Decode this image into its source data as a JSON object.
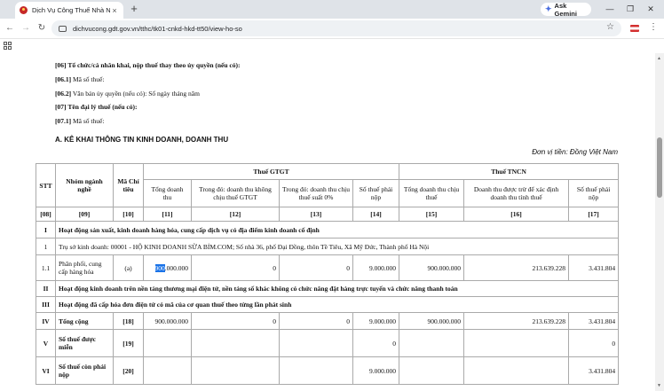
{
  "browser": {
    "tab_title": "Dịch Vụ Công Thuế Nhà Nước",
    "tab_close": "×",
    "new_tab": "+",
    "gemini_label": "Ask Gemini",
    "url": "dichvucong.gdt.gov.vn/tthc/tk01-cnkd-hkd-tt50/view-ho-so",
    "icons": [
      "back-arrow-icon",
      "forward-arrow-icon",
      "reload-icon",
      "site-settings-icon",
      "bookmark-star-icon",
      "menu-icon",
      "apps-icon",
      "minimize-icon",
      "maximize-icon",
      "close-icon"
    ]
  },
  "form": {
    "f06": {
      "code": "[06]",
      "text": "Tổ chức/cá nhân khai, nộp thuế thay theo ủy quyền (nếu có):"
    },
    "f061": {
      "code": "[06.1]",
      "text": "Mã số thuế:"
    },
    "f062": {
      "code": "[06.2]",
      "text": "Văn bản ủy quyền (nếu có): Số ngày tháng năm"
    },
    "f07": {
      "code": "[07]",
      "text": "Tên đại lý thuế (nếu có):"
    },
    "f071": {
      "code": "[07.1]",
      "text": "Mã số thuế:"
    },
    "section_a": "A. KÊ KHAI THÔNG TIN KINH DOANH, DOANH THU",
    "currency": "Đơn vị tiền: Đồng Việt Nam"
  },
  "table": {
    "headers": {
      "stt": "STT",
      "nhom": "Nhóm ngành nghề",
      "ma": "Mã Chỉ tiêu",
      "gtgt": "Thuế GTGT",
      "tncn": "Thuế TNCN",
      "c11": "Tổng doanh thu",
      "c12": "Trong đó: doanh thu không chịu thuế GTGT",
      "c13": "Trong đó: doanh thu chịu thuế suất 0%",
      "c14": "Số thuế phải nộp",
      "c15": "Tổng doanh thu chịu thuế",
      "c16": "Doanh thu được trừ để xác định doanh thu tính thuế",
      "c17": "Số thuế phải nộp"
    },
    "codes": [
      "[08]",
      "[09]",
      "[10]",
      "[11]",
      "[12]",
      "[13]",
      "[14]",
      "[15]",
      "[16]",
      "[17]"
    ],
    "row_I": {
      "stt": "I",
      "text": "Hoạt động sản xuất, kinh doanh hàng hóa, cung cấp dịch vụ có địa điểm kinh doanh cố định"
    },
    "row_1": {
      "stt": "1",
      "text": "Trụ sở kinh doanh: 00001 - HỘ KINH DOANH SỮA BỈM.COM; Số nhà 36, phố Đại Đồng, thôn Tề Tiêu, Xã Mỹ Đức, Thành phố Hà Nội"
    },
    "row_11": {
      "stt": "1.1",
      "nhom": "Phân phối, cung cấp hàng hóa",
      "ma": "(a)",
      "c11_sel": "900",
      "c11_rest": ".000.000",
      "c12": "0",
      "c13": "0",
      "c14": "9.000.000",
      "c15": "900.000.000",
      "c16": "213.639.228",
      "c17": "3.431.804"
    },
    "row_II": {
      "stt": "II",
      "text": "Hoạt động kinh doanh trên nền tảng thương mại điện tử, nền tảng số khác không có chức năng đặt hàng trực tuyến và chức năng thanh toán"
    },
    "row_III": {
      "stt": "III",
      "text": "Hoạt động đã cấp hóa đơn điện tử có mã của cơ quan thuế theo từng lần phát sinh"
    },
    "row_IV": {
      "stt": "IV",
      "nhom": "Tổng cộng",
      "ma": "[18]",
      "c11": "900.000.000",
      "c12": "0",
      "c13": "0",
      "c14": "9.000.000",
      "c15": "900.000.000",
      "c16": "213.639.228",
      "c17": "3.431.804"
    },
    "row_V": {
      "stt": "V",
      "nhom": "Số thuế được miễn",
      "ma": "[19]",
      "c14": "0",
      "c17": "0"
    },
    "row_VI": {
      "stt": "VI",
      "nhom": "Số thuế còn phải nộp",
      "ma": "[20]",
      "c14": "9.000.000",
      "c17": "3.431.804"
    }
  }
}
